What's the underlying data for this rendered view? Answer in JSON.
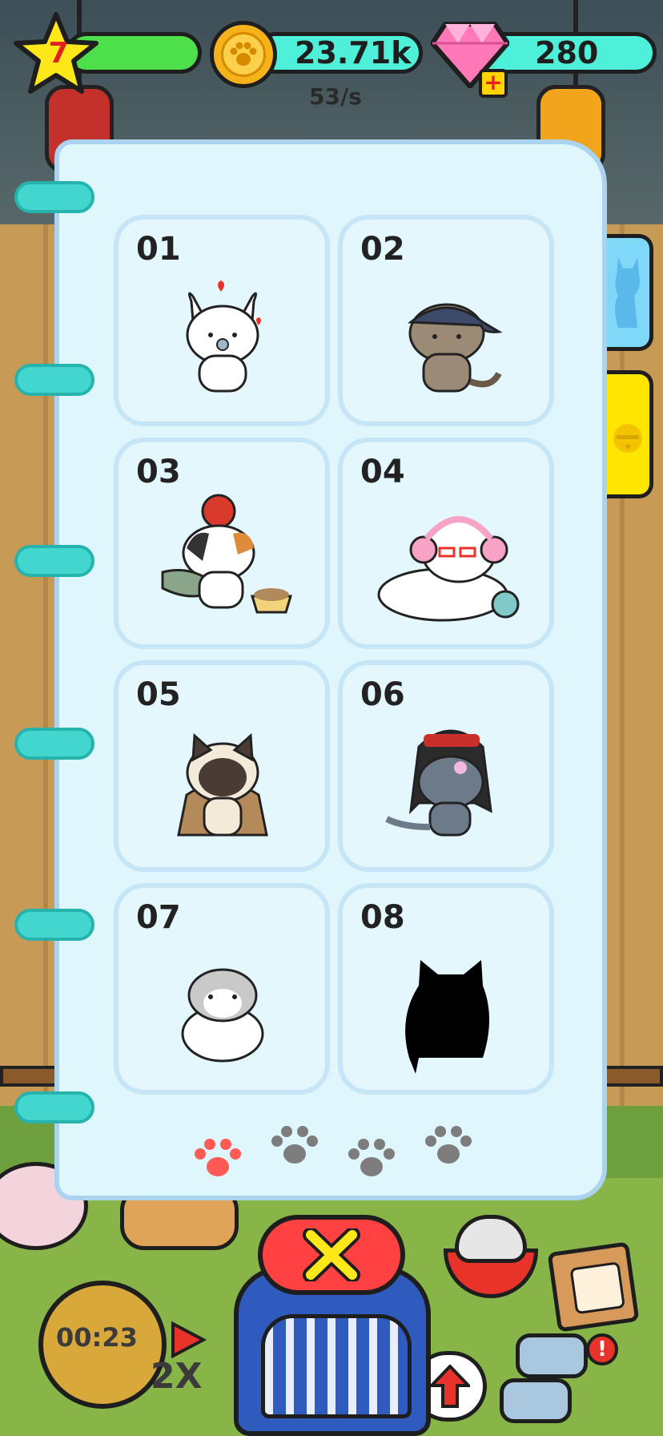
{
  "hud": {
    "level": "7",
    "coins": "23.71k",
    "coin_rate": "53/s",
    "gems": "280",
    "level_bar_color": "#4de04b",
    "coin_bar_color": "#4ff0d9",
    "gem_bar_color": "#4ff0d9"
  },
  "collection": {
    "cards": [
      {
        "number": "01",
        "cat": "white-cat-hearts",
        "locked": false
      },
      {
        "number": "02",
        "cat": "tabby-cat-cap",
        "locked": false
      },
      {
        "number": "03",
        "cat": "calico-cat-daruma",
        "locked": false
      },
      {
        "number": "04",
        "cat": "persian-cat-earmuffs",
        "locked": false
      },
      {
        "number": "05",
        "cat": "siamese-cat-cloak",
        "locked": false
      },
      {
        "number": "06",
        "cat": "gray-cat-hat",
        "locked": false
      },
      {
        "number": "07",
        "cat": "scottish-fold-cat",
        "locked": false
      },
      {
        "number": "08",
        "cat": "cat-silhouette",
        "locked": true
      }
    ],
    "pages": [
      "paw-icon",
      "paw-icon",
      "paw-icon",
      "paw-icon"
    ],
    "active_page": 1,
    "active_color": "#ff5b55",
    "inactive_color": "#7d7d7d"
  },
  "side_tabs": [
    {
      "icon": "cat-icon",
      "color": "#7fd8f8"
    },
    {
      "icon": "bell-icon",
      "color": "#ffe600"
    }
  ],
  "bottom": {
    "timer": "00:23",
    "multiplier": "2X",
    "close_icon": "close-icon"
  }
}
